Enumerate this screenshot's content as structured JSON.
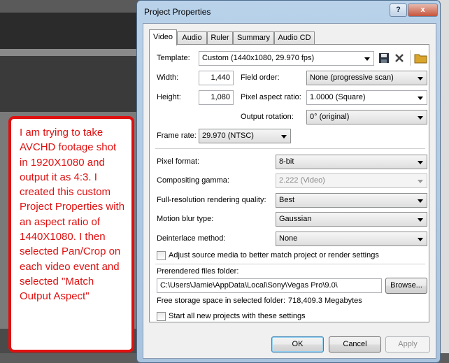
{
  "note": {
    "text": "I am trying to take AVCHD footage shot in 1920X1080 and output it as 4:3. I created this custom Project Properties with an aspect ratio of 1440X1080.  I then selected Pan/Crop on each video event and selected \"Match Output Aspect\""
  },
  "dialog": {
    "title": "Project Properties",
    "help_label": "?",
    "close_label": "x",
    "tabs": [
      {
        "label": "Video"
      },
      {
        "label": "Audio"
      },
      {
        "label": "Ruler"
      },
      {
        "label": "Summary"
      },
      {
        "label": "Audio CD"
      }
    ],
    "template": {
      "label": "Template:",
      "value": "Custom (1440x1080, 29.970 fps)"
    },
    "width": {
      "label": "Width:",
      "value": "1,440"
    },
    "height": {
      "label": "Height:",
      "value": "1,080"
    },
    "field_order": {
      "label": "Field order:",
      "value": "None (progressive scan)"
    },
    "pixel_aspect": {
      "label": "Pixel aspect ratio:",
      "value": "1.0000 (Square)"
    },
    "output_rotation": {
      "label": "Output rotation:",
      "value": "0° (original)"
    },
    "frame_rate": {
      "label": "Frame rate:",
      "value": "29.970 (NTSC)"
    },
    "pixel_format": {
      "label": "Pixel format:",
      "value": "8-bit"
    },
    "compositing_gamma": {
      "label": "Compositing gamma:",
      "value": "2.222 (Video)"
    },
    "rendering_quality": {
      "label": "Full-resolution rendering quality:",
      "value": "Best"
    },
    "motion_blur": {
      "label": "Motion blur type:",
      "value": "Gaussian"
    },
    "deinterlace": {
      "label": "Deinterlace method:",
      "value": "None"
    },
    "adjust_source": {
      "label": "Adjust source media to better match project or render settings"
    },
    "prerendered": {
      "label": "Prerendered files folder:",
      "value": "C:\\Users\\Jamie\\AppData\\Local\\Sony\\Vegas Pro\\9.0\\",
      "browse_label": "Browse..."
    },
    "free_space": {
      "label": "Free storage space in selected folder:",
      "value": "718,409.3 Megabytes"
    },
    "start_all": {
      "label": "Start all new projects with these settings"
    },
    "ok_label": "OK",
    "cancel_label": "Cancel",
    "apply_label": "Apply"
  },
  "colors": {
    "note_red": "#e01010",
    "title_blue": "#b9d2ea"
  }
}
